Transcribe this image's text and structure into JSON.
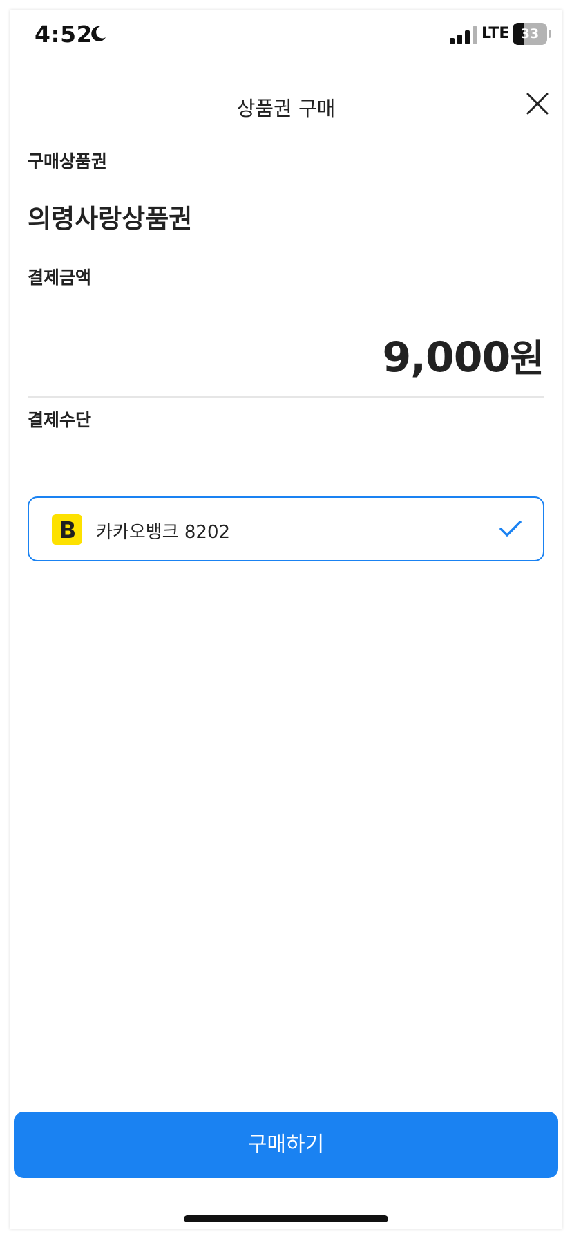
{
  "status_bar": {
    "time": "4:52",
    "network": "LTE",
    "battery_level": "33",
    "battery_fraction": 0.33,
    "icons": [
      "moon-icon",
      "signal-icon",
      "battery-icon"
    ]
  },
  "header": {
    "title": "상품권 구매",
    "close_icon": "close-icon"
  },
  "voucher": {
    "label": "구매상품권",
    "name": "의령사랑상품권"
  },
  "amount": {
    "label": "결제금액",
    "value": "9,000",
    "unit": "원"
  },
  "payment": {
    "label": "결제수단",
    "selected_method": "카카오뱅크 8202",
    "logo_letter": "B",
    "logo_color": "#fde100",
    "selected": true
  },
  "actions": {
    "purchase_label": "구매하기"
  },
  "colors": {
    "accent": "#1a82f2",
    "text": "#222222",
    "divider": "#e6e6e6"
  }
}
